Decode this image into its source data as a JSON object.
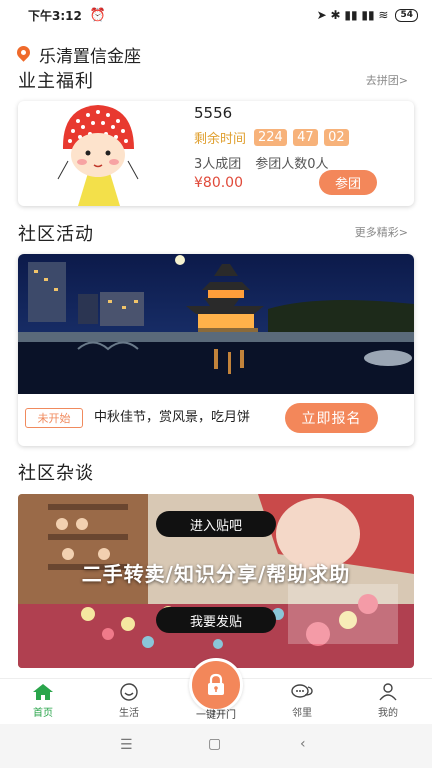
{
  "status_bar": {
    "time": "下午3:12",
    "alarm": "⏰",
    "icons": "➤ ✱ ▮▮ ▮▮ ≋",
    "battery": "54"
  },
  "location": {
    "name": "乐清置信金座"
  },
  "owner_benefits": {
    "title": "业主福利",
    "more": "去拼团>",
    "item": {
      "title": "5556",
      "remaining_label": "剩余时间",
      "hours": "224",
      "minutes": "47",
      "seconds": "02",
      "group_size": "3人成团",
      "joined": "参团人数0人",
      "price": "¥80.00",
      "join_label": "参团"
    }
  },
  "community_activity": {
    "title": "社区活动",
    "more": "更多精彩>",
    "item": {
      "status": "未开始",
      "description": "中秋佳节，赏风景，吃月饼",
      "signup_label": "立即报名"
    }
  },
  "community_talk": {
    "title": "社区杂谈",
    "enter_label": "进入贴吧",
    "slogan": "二手转卖/知识分享/帮助求助",
    "post_label": "我要发贴"
  },
  "bottom_nav": {
    "items": [
      {
        "label": "首页",
        "icon": "home-icon"
      },
      {
        "label": "生活",
        "icon": "smile-icon"
      },
      {
        "label": "一键开门",
        "icon": "lock-icon"
      },
      {
        "label": "邻里",
        "icon": "chat-icon"
      },
      {
        "label": "我的",
        "icon": "person-icon"
      }
    ]
  },
  "colors": {
    "accent": "#f3875a",
    "active_nav": "#2aa54b",
    "price": "#e04a3a",
    "countdown_label": "#e0a030"
  }
}
